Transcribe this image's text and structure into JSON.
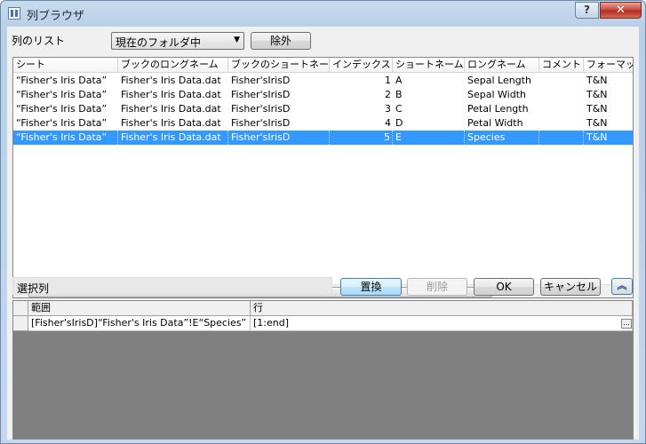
{
  "window": {
    "title": "列ブラウザ",
    "help": "?",
    "close": "✕"
  },
  "top": {
    "list_label": "列のリスト",
    "folder_select": "現在のフォルダ中",
    "exclude_button": "除外"
  },
  "columns": [
    "シート",
    "ブックのロングネーム",
    "ブックのショートネーム",
    "インデックス",
    "ショートネーム",
    "ロングネーム",
    "コメント",
    "フォーマット"
  ],
  "rows": [
    [
      "“Fisher's Iris Data”",
      "Fisher's Iris Data.dat",
      "Fisher'sIrisD",
      "1",
      "A",
      "Sepal Length",
      "",
      "T&N"
    ],
    [
      "“Fisher's Iris Data”",
      "Fisher's Iris Data.dat",
      "Fisher'sIrisD",
      "2",
      "B",
      "Sepal Width",
      "",
      "T&N"
    ],
    [
      "“Fisher's Iris Data”",
      "Fisher's Iris Data.dat",
      "Fisher'sIrisD",
      "3",
      "C",
      "Petal Length",
      "",
      "T&N"
    ],
    [
      "“Fisher's Iris Data”",
      "Fisher's Iris Data.dat",
      "Fisher'sIrisD",
      "4",
      "D",
      "Petal Width",
      "",
      "T&N"
    ],
    [
      "“Fisher's Iris Data”",
      "Fisher's Iris Data.dat",
      "Fisher'sIrisD",
      "5",
      "E",
      "Species",
      "",
      "T&N"
    ]
  ],
  "selected_row": 4,
  "scrollbar": {
    "grip": "III"
  },
  "middle": {
    "selected_label": "選択列",
    "replace": "置換",
    "delete": "削除",
    "ok": "OK",
    "cancel": "キャンセル",
    "collapse_icon": "double-chevron-up-icon"
  },
  "grid": {
    "headers": [
      "範囲",
      "行"
    ],
    "row": [
      "[Fisher'sIrisD]“Fisher's Iris Data”!E“Species”",
      "[1:end]"
    ],
    "ellipsis": "..."
  },
  "colors": {
    "selection": "#3399ff",
    "grid_bg": "#808080"
  }
}
